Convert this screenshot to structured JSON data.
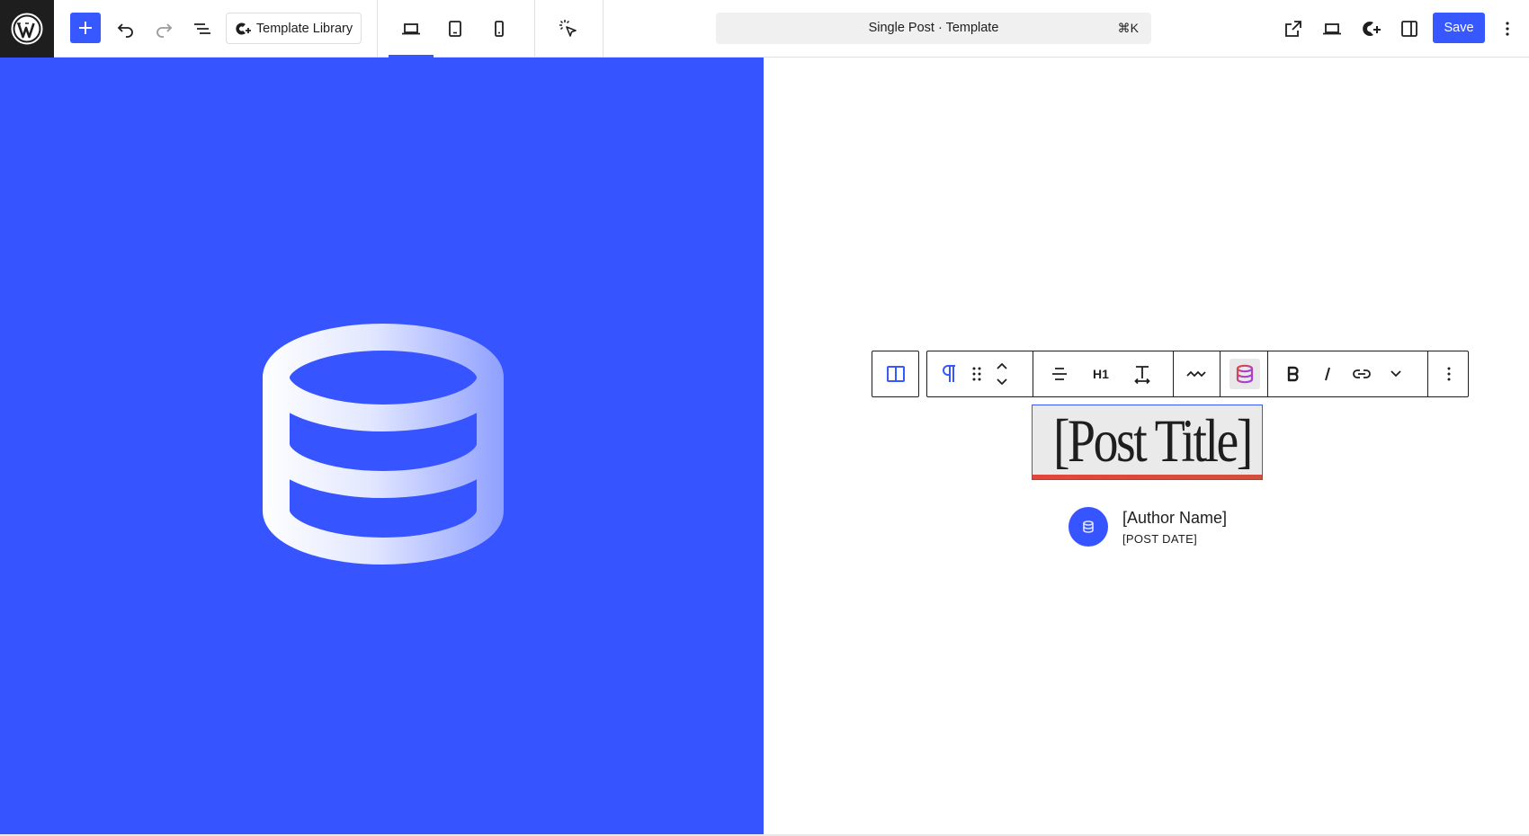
{
  "header": {
    "template_library_label": "Template Library",
    "command_bar_title": "Single Post · Template",
    "command_bar_shortcut": "⌘K",
    "save_label": "Save"
  },
  "colors": {
    "accent": "#3858ff",
    "hero_background": "#3654ff",
    "title_underline": "#e2463a"
  },
  "icons": {
    "wordpress": "wordpress-logo-icon",
    "add": "plus-icon",
    "undo": "undo-icon",
    "redo": "redo-icon",
    "document_overview": "list-view-icon",
    "template_library": "library-sparkle-icon",
    "device_desktop": "desktop-icon",
    "device_tablet": "tablet-icon",
    "device_mobile": "mobile-icon",
    "interactions": "cursor-sparkle-icon",
    "view_external": "external-link-icon",
    "preview": "preview-desktop-icon",
    "ai": "ai-sparkle-icon",
    "settings": "sidebar-toggle-icon",
    "options": "more-vertical-icon",
    "hero_image": "database-icon"
  },
  "block_toolbar": {
    "heading_level": "H1",
    "items": [
      "columns",
      "paragraph",
      "drag",
      "move-up-down",
      "align",
      "heading-level",
      "width",
      "squiggle",
      "database",
      "bold",
      "italic",
      "link",
      "more-chevron",
      "options"
    ]
  },
  "content": {
    "post_title": "[Post Title]",
    "author_name": "[Author Name]",
    "post_date": "[POST DATE]"
  }
}
